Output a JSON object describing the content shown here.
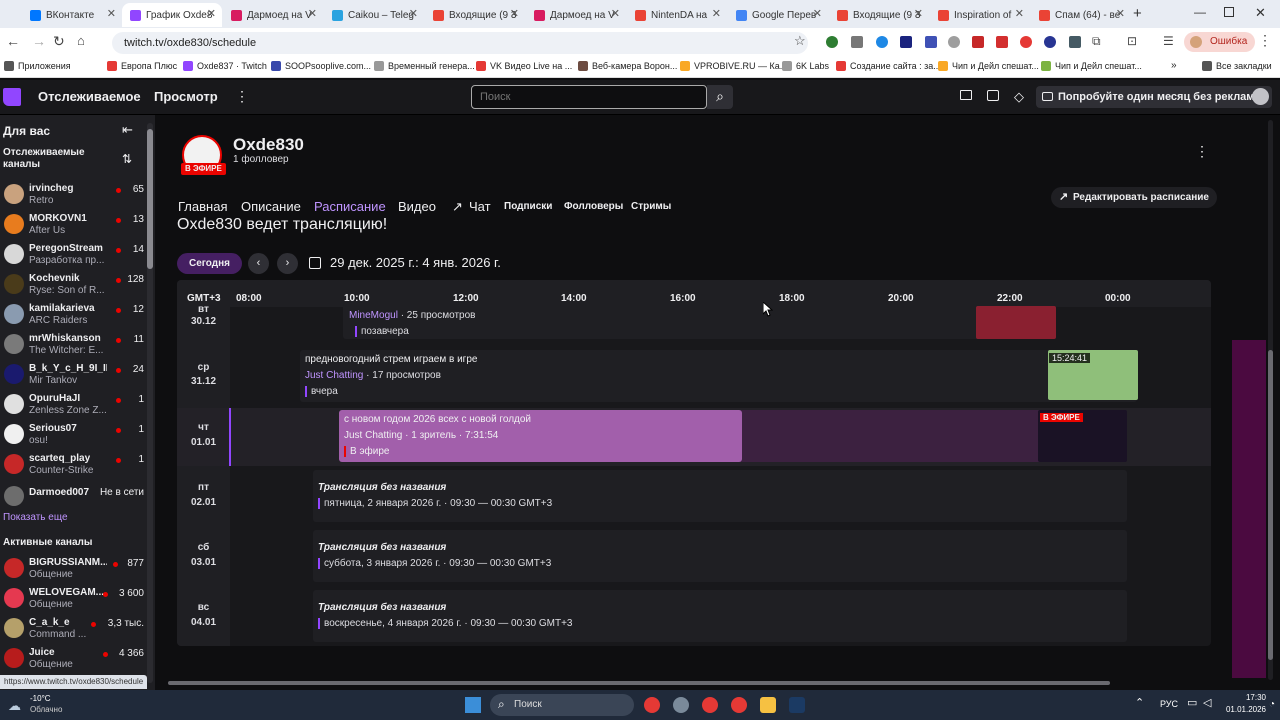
{
  "browser": {
    "tabs": [
      {
        "label": "ВКонтакте",
        "color": "#0077ff"
      },
      {
        "label": "График Oxde8",
        "color": "#9146ff",
        "active": true
      },
      {
        "label": "Дармоед на V",
        "color": "#d81b60"
      },
      {
        "label": "Caikou – Teleg",
        "color": "#2aa3e0"
      },
      {
        "label": "Входящие (9 3",
        "color": "#ea4335"
      },
      {
        "label": "Дармоед на V",
        "color": "#d81b60"
      },
      {
        "label": "NintenDA на",
        "color": "#ea4335"
      },
      {
        "label": "Google Перев",
        "color": "#4285f4"
      },
      {
        "label": "Входящие (9 3",
        "color": "#ea4335"
      },
      {
        "label": "Inspiration of",
        "color": "#ea4335"
      },
      {
        "label": "Спам (64) - ве",
        "color": "#ea4335"
      }
    ],
    "url": "twitch.tv/oxde830/schedule",
    "error_badge": "Ошибка",
    "bookmarks": [
      {
        "label": "Приложения",
        "color": "#555"
      },
      {
        "label": "Европа Плюс",
        "color": "#e53935"
      },
      {
        "label": "Oxde837 · Twitch",
        "color": "#9146ff"
      },
      {
        "label": "SOOPsooplive.com...",
        "color": "#3949ab"
      },
      {
        "label": "Временный генера...",
        "color": "#999"
      },
      {
        "label": "VK Видео Live на ...",
        "color": "#e53935"
      },
      {
        "label": "Веб-камера Ворон...",
        "color": "#6d4c41"
      },
      {
        "label": "VPROBIVE.RU — Ка...",
        "color": "#f9a825"
      },
      {
        "label": "6K Labs",
        "color": "#999"
      },
      {
        "label": "Создание сайта : за...",
        "color": "#e53935"
      },
      {
        "label": "Чип и Дейл спешат...",
        "color": "#f9a825"
      },
      {
        "label": "Чип и Дейл спешат...",
        "color": "#7cb342"
      },
      {
        "label": "Все закладки",
        "color": "#555"
      }
    ]
  },
  "topnav": {
    "following": "Отслеживаемое",
    "browse": "Просмотр",
    "search_placeholder": "Поиск",
    "promo": "Попробуйте один месяц без рекламы"
  },
  "sidebar": {
    "for_you": "Для вас",
    "followed_title": "Отслеживаемые каналы",
    "channels": [
      {
        "name": "irvincheg",
        "game": "Retro",
        "viewers": "65",
        "color": "#c9a27e"
      },
      {
        "name": "MORKOVN1",
        "game": "After Us",
        "viewers": "13",
        "color": "#e87c1e"
      },
      {
        "name": "PeregonStream",
        "game": "Разработка пр...",
        "viewers": "14",
        "color": "#d8d8d8"
      },
      {
        "name": "Kochevnik",
        "game": "Ryse: Son of R...",
        "viewers": "128",
        "color": "#4a3b1a"
      },
      {
        "name": "kamilakarieva",
        "game": "ARC Raiders",
        "viewers": "12",
        "color": "#8a9bb0"
      },
      {
        "name": "mrWhiskanson",
        "game": "The Witcher: E...",
        "viewers": "11",
        "color": "#7a7a7a"
      },
      {
        "name": "B_k_Y_c_H_9I_II...",
        "game": "Mir Tankov",
        "viewers": "24",
        "color": "#1a1a6e"
      },
      {
        "name": "OpuruHaJI",
        "game": "Zenless Zone Z...",
        "viewers": "1",
        "color": "#e0e0e0"
      },
      {
        "name": "Serious07",
        "game": "osu!",
        "viewers": "1",
        "color": "#f0f0f0"
      },
      {
        "name": "scarteq_play",
        "game": "Counter-Strike",
        "viewers": "1",
        "color": "#c62828"
      }
    ],
    "offline_channel": {
      "name": "Darmoed007",
      "status": "Не в сети"
    },
    "show_more": "Показать еще",
    "active_title": "Активные каналы",
    "active": [
      {
        "name": "BIGRUSSIANM...",
        "game": "Общение",
        "viewers": "877",
        "color": "#c62828"
      },
      {
        "name": "WELOVEGAM...",
        "game": "Общение",
        "viewers": "3 600",
        "color": "#e53950"
      },
      {
        "name": "C_a_k_e",
        "game": "Command ...",
        "viewers": "3,3 тыс.",
        "color": "#b5a06a"
      },
      {
        "name": "Juice",
        "game": "Общение",
        "viewers": "4 366",
        "color": "#b71c1c"
      }
    ]
  },
  "channel": {
    "name": "Oxde830",
    "followers": "1 фолловер",
    "live_badge": "В ЭФИРЕ",
    "tabs": [
      "Главная",
      "Описание",
      "Расписание",
      "Видео",
      "Чат"
    ],
    "tabs_small": [
      "Подписки",
      "Фолловеры",
      "Стримы"
    ],
    "edit_schedule": "Редактировать расписание",
    "headline": "Oxde830 ведет трансляцию!"
  },
  "schedule": {
    "today_button": "Сегодня",
    "date_range": "29 дек. 2025 г.: 4 янв. 2026 г.",
    "timezone": "GMT+3",
    "hours": [
      "08:00",
      "10:00",
      "12:00",
      "14:00",
      "16:00",
      "18:00",
      "20:00",
      "22:00",
      "00:00"
    ],
    "rows": [
      {
        "dow": "вт",
        "date": "30.12",
        "cat": "MineMogul",
        "meta": " · 25 просмотров",
        "when": "позавчера"
      },
      {
        "dow": "ср",
        "date": "31.12",
        "title": "предновогодний стрем играем в игре",
        "cat": "Just Chatting",
        "meta": " · 17 просмотров",
        "when": "вчера",
        "duration": "15:24:41"
      },
      {
        "dow": "чт",
        "date": "01.01",
        "title": "с новом годом 2026 всех с новой голдой",
        "cat": "Just Chatting",
        "meta": " · 1 зритель · 7:31:54",
        "when": "В эфире",
        "badge": "В ЭФИРЕ"
      },
      {
        "dow": "пт",
        "date": "02.01",
        "title": "Трансляция без названия",
        "info": "пятница, 2 января 2026 г. · 09:30 — 00:30 GMT+3"
      },
      {
        "dow": "сб",
        "date": "03.01",
        "title": "Трансляция без названия",
        "info": "суббота, 3 января 2026 г. · 09:30 — 00:30 GMT+3"
      },
      {
        "dow": "вс",
        "date": "04.01",
        "title": "Трансляция без названия",
        "info": "воскресенье, 4 января 2026 г. · 09:30 — 00:30 GMT+3"
      }
    ]
  },
  "status_url": "https://www.twitch.tv/oxde830/schedule",
  "taskbar": {
    "weather_temp": "-10°C",
    "weather_desc": "Облачно",
    "search": "Поиск",
    "lang": "РУС",
    "time": "17:30",
    "date": "01.01.2026"
  },
  "colors": {
    "accent": "#9146ff",
    "live": "#eb0400",
    "schedule_link": "#bf94ff"
  }
}
